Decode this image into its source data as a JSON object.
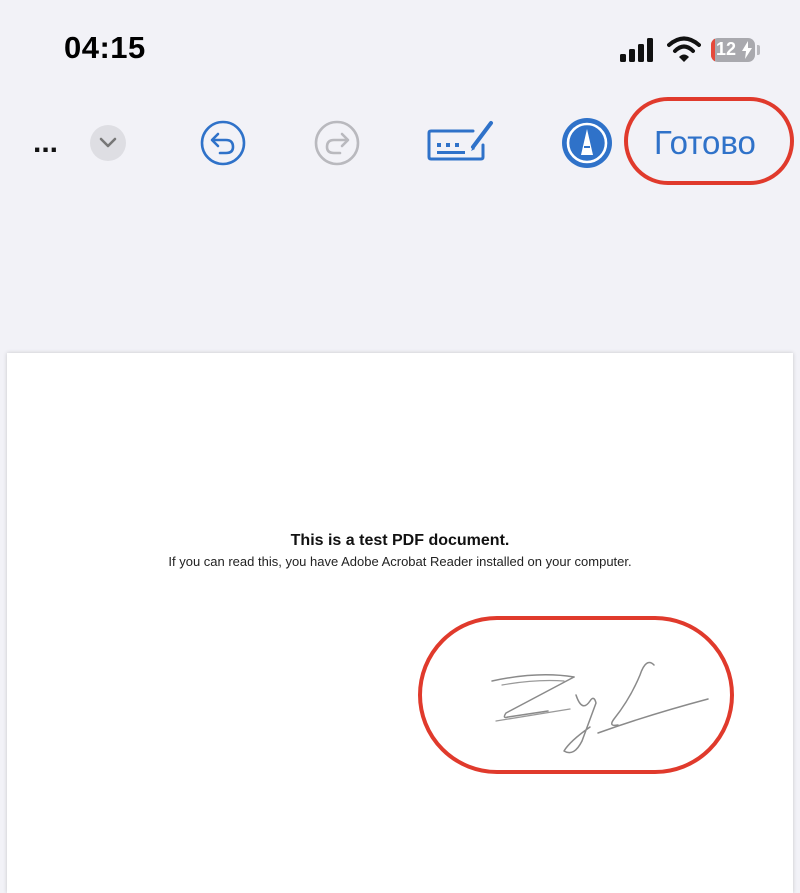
{
  "status_bar": {
    "time": "04:15",
    "battery_level": "12"
  },
  "toolbar": {
    "more_label": "...",
    "done_label": "Готово"
  },
  "document": {
    "title": "This is a test PDF document.",
    "subtitle": "If you can read this, you have Adobe Acrobat Reader installed on your computer."
  },
  "icons": [
    "signal-icon",
    "wifi-icon",
    "battery-icon",
    "chevron-down-icon",
    "undo-icon",
    "redo-icon",
    "keyboard-icon",
    "markup-pen-icon"
  ],
  "colors": {
    "accent": "#2f72c9",
    "highlight": "#e03a2c",
    "background": "#f2f2f7"
  }
}
